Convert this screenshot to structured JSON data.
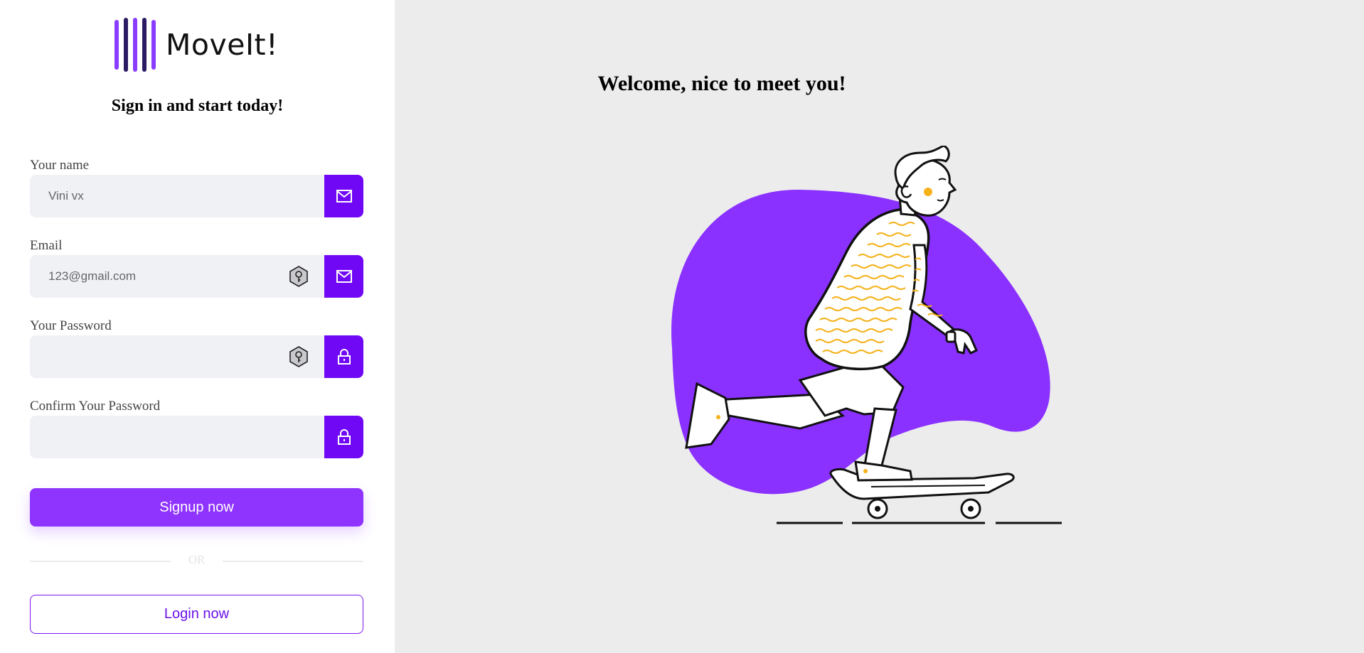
{
  "brand": {
    "name": "MoveIt!",
    "bar_colors": [
      "#8b3dff",
      "#2b1b63",
      "#8b3dff",
      "#2b1b63",
      "#8b3dff"
    ]
  },
  "form": {
    "subtitle": "Sign in and start today!",
    "name_field": {
      "label": "Your name",
      "placeholder": "Vini vx",
      "icon": "mail-icon"
    },
    "email_field": {
      "label": "Email",
      "placeholder": "123@gmail.com",
      "icon": "mail-icon"
    },
    "password_field": {
      "label": "Your Password",
      "placeholder": "",
      "icon": "lock-icon"
    },
    "confirm_password_field": {
      "label": "Confirm Your Password",
      "placeholder": "",
      "icon": "lock-icon"
    },
    "signup_label": "Signup now",
    "or_label": "OR",
    "login_label": "Login now"
  },
  "hero": {
    "title": "Welcome, nice to meet you!",
    "illustration": "skateboarder-illustration"
  },
  "colors": {
    "accent": "#7108f5",
    "accent_light": "#8f33ff",
    "blob": "#8b31ff",
    "stripes": "#f5b21b",
    "panel_bg": "#ececec",
    "input_bg": "#f0f1f5"
  }
}
